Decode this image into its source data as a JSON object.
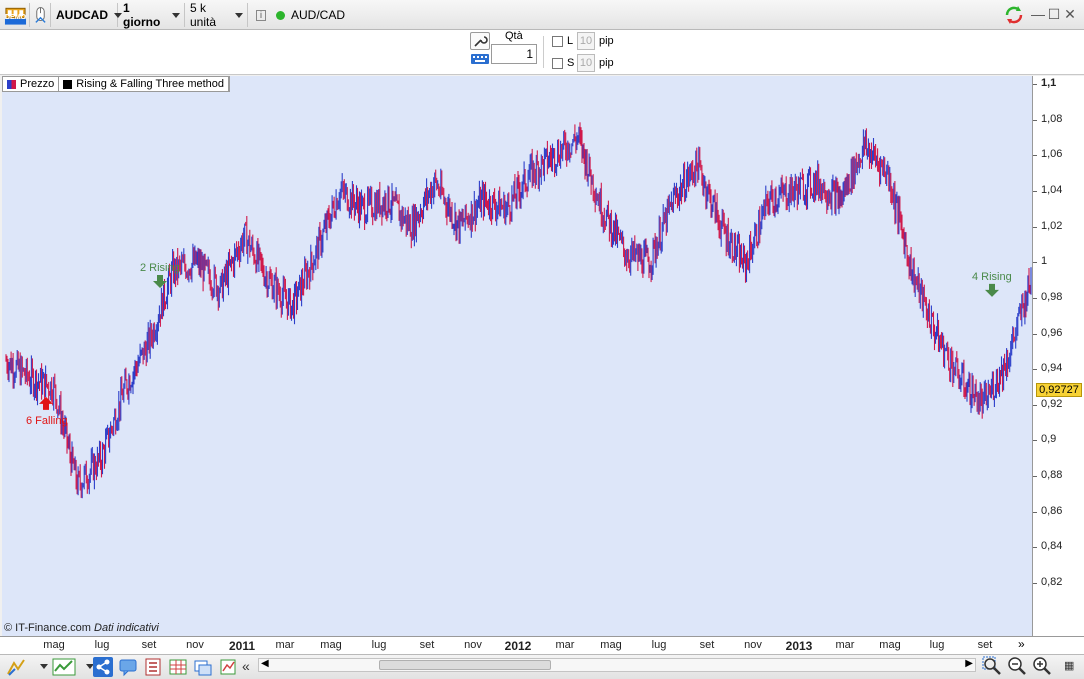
{
  "toolbar": {
    "account_badge": "DEMO",
    "symbol": "AUDCAD",
    "timeframe": "1 giorno",
    "units": "5 k unità",
    "instrument": "AUD/CAD",
    "status_color": "#2cb52c"
  },
  "order": {
    "qty_label": "Qtà",
    "qty_value": "1",
    "limit_label": "L",
    "stop_label": "S",
    "limit_pips": "10",
    "stop_pips": "10",
    "pip_unit": "pip"
  },
  "legend": {
    "price": "Prezzo",
    "indicator": "Rising & Falling Three method"
  },
  "credit": {
    "source": "© IT-Finance.com",
    "note": "Dati indicativi"
  },
  "colors": {
    "up_bar": "#2b3ec9",
    "down_bar": "#d0184a",
    "plot_bg": "#dde6f9",
    "rising_signal": "#4a8a4a",
    "falling_signal": "#e01414",
    "price_tag": "#f7d235"
  },
  "chart_data": {
    "type": "line",
    "title": "",
    "xlabel": "",
    "ylabel": "",
    "ylim": [
      0.8,
      1.1
    ],
    "y_ticks": [
      "1,1",
      "1,08",
      "1,06",
      "1,04",
      "1,02",
      "1",
      "0,98",
      "0,96",
      "0,94",
      "0,92",
      "0,9",
      "0,88",
      "0,86",
      "0,84",
      "0,82"
    ],
    "x_ticks": [
      {
        "label": "mag",
        "year": false
      },
      {
        "label": "lug",
        "year": false
      },
      {
        "label": "set",
        "year": false
      },
      {
        "label": "nov",
        "year": false
      },
      {
        "label": "2011",
        "year": true
      },
      {
        "label": "mar",
        "year": false
      },
      {
        "label": "mag",
        "year": false
      },
      {
        "label": "lug",
        "year": false
      },
      {
        "label": "set",
        "year": false
      },
      {
        "label": "nov",
        "year": false
      },
      {
        "label": "2012",
        "year": true
      },
      {
        "label": "mar",
        "year": false
      },
      {
        "label": "mag",
        "year": false
      },
      {
        "label": "lug",
        "year": false
      },
      {
        "label": "set",
        "year": false
      },
      {
        "label": "nov",
        "year": false
      },
      {
        "label": "2013",
        "year": true
      },
      {
        "label": "mar",
        "year": false
      },
      {
        "label": "mag",
        "year": false
      },
      {
        "label": "lug",
        "year": false
      },
      {
        "label": "set",
        "year": false
      }
    ],
    "series": [
      {
        "name": "Prezzo",
        "x": [
          "mar 2010",
          "apr 2010",
          "mag 2010",
          "giu 2010",
          "lug 2010",
          "ago 2010",
          "set 2010",
          "ott 2010",
          "nov 2010",
          "dic 2010",
          "gen 2011",
          "feb 2011",
          "mar 2011",
          "apr 2011",
          "mag 2011",
          "giu 2011",
          "lug 2011",
          "ago 2011",
          "set 2011",
          "ott 2011",
          "nov 2011",
          "dic 2011",
          "gen 2012",
          "feb 2012",
          "mar 2012",
          "apr 2012",
          "mag 2012",
          "giu 2012",
          "lug 2012",
          "ago 2012",
          "set 2012",
          "ott 2012",
          "nov 2012",
          "dic 2012",
          "gen 2013",
          "feb 2013",
          "mar 2013",
          "apr 2013",
          "mag 2013",
          "giu 2013",
          "lug 2013",
          "ago 2013",
          "set 2013",
          "ott 2013"
        ],
        "values": [
          0.945,
          0.935,
          0.93,
          0.875,
          0.89,
          0.93,
          0.955,
          0.995,
          1.0,
          0.985,
          1.015,
          0.99,
          0.975,
          1.005,
          1.04,
          1.03,
          1.035,
          1.02,
          1.045,
          1.02,
          1.035,
          1.03,
          1.05,
          1.06,
          1.07,
          1.03,
          1.005,
          1.0,
          1.035,
          1.055,
          1.02,
          0.998,
          1.035,
          1.04,
          1.045,
          1.035,
          1.065,
          1.05,
          0.995,
          0.96,
          0.935,
          0.92,
          0.945,
          0.99
        ]
      }
    ],
    "last_price": "0,92727",
    "annotations": [
      {
        "label": "6  Falling",
        "kind": "falling",
        "x": "apr 2010",
        "y": 0.925
      },
      {
        "label": "2  Rising",
        "kind": "rising",
        "x": "set 2010",
        "y": 0.985
      },
      {
        "label": "4  Rising",
        "kind": "rising",
        "x": "set 2013",
        "y": 0.98
      }
    ],
    "grid": false
  }
}
